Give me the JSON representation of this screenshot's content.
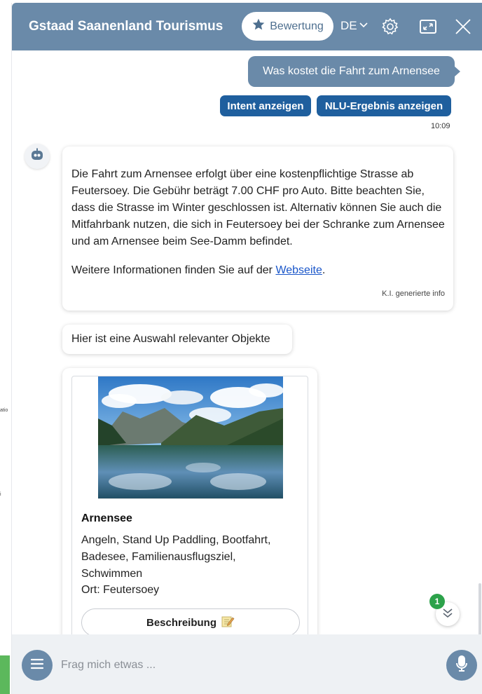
{
  "background": {
    "side_text": "atio",
    "side_text2": "i"
  },
  "header": {
    "title": "Gstaad Saanenland Tourismus",
    "rating_label": "Bewertung",
    "language": "DE",
    "icons": [
      "star-icon",
      "chevron-down-icon",
      "gear-icon",
      "maximize-icon",
      "close-icon"
    ],
    "color": "#6a8aa9"
  },
  "chat": {
    "user_message": "Was kostet die Fahrt zum Arnensee",
    "buttons": {
      "intent": "Intent anzeigen",
      "nlu": "NLU-Ergebnis anzeigen"
    },
    "time": "10:09",
    "answer": {
      "text": "Die Fahrt zum Arnensee erfolgt über eine kostenpflichtige Strasse ab Feutersoey. Die Gebühr beträgt 7.00 CHF pro Auto. Bitte beachten Sie, dass die Strasse im Winter geschlossen ist. Alternativ können Sie auch die Mitfahrbank nutzen, die sich in Feutersoey bei der Schranke zum Arnensee und am Arnensee beim See-Damm befindet.",
      "more_prefix": "Weitere Informationen finden Sie auf der ",
      "more_link": "Webseite",
      "more_suffix": ".",
      "ki_label": "K.I. generierte info"
    },
    "selection_text": "Hier ist eine Auswahl relevanter Objekte",
    "card": {
      "title": "Arnensee",
      "activities": "Angeln, Stand Up Paddling, Bootfahrt, Badesee, Familienausflugsziel, Schwimmen",
      "location": "Ort: Feutersoey",
      "button_label": "Beschreibung"
    },
    "unread_count": "1"
  },
  "footer": {
    "placeholder": "Frag mich etwas ..."
  }
}
